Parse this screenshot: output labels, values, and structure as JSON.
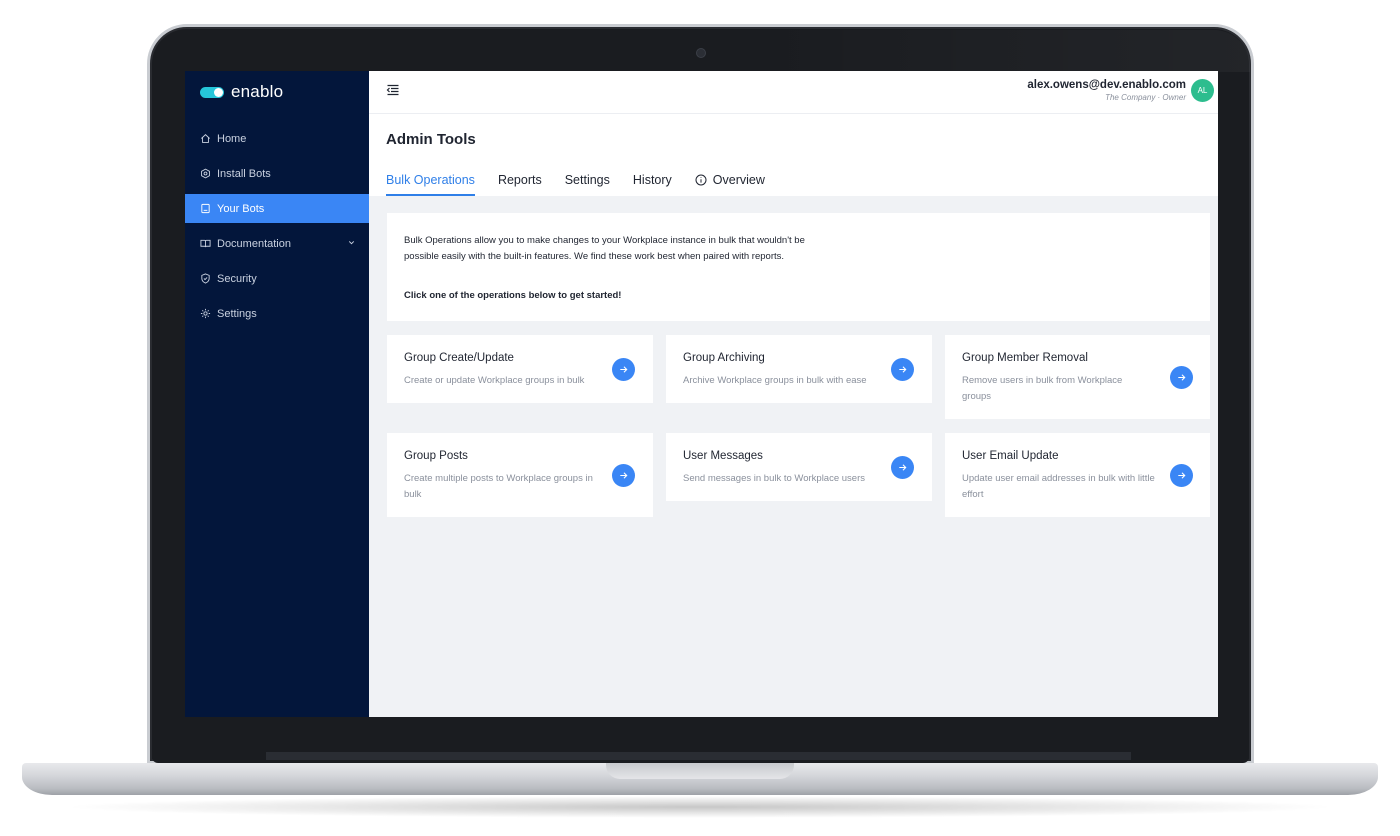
{
  "brand": {
    "name": "enablo",
    "logo_color": "#26c6da"
  },
  "sidebar": {
    "items": [
      {
        "label": "Home",
        "icon": "home-icon"
      },
      {
        "label": "Install Bots",
        "icon": "install-icon"
      },
      {
        "label": "Your Bots",
        "icon": "bot-icon",
        "active": true
      },
      {
        "label": "Documentation",
        "icon": "book-icon",
        "has_submenu": true
      },
      {
        "label": "Security",
        "icon": "shield-icon"
      },
      {
        "label": "Settings",
        "icon": "gear-icon"
      }
    ]
  },
  "header": {
    "menu_icon": "menu-collapse-icon",
    "user_email": "alex.owens@dev.enablo.com",
    "user_role": "The Company · Owner",
    "avatar_initials": "AL",
    "avatar_color": "#2dbd8e"
  },
  "page": {
    "title": "Admin Tools",
    "tabs": [
      {
        "label": "Bulk Operations",
        "active": true
      },
      {
        "label": "Reports"
      },
      {
        "label": "Settings"
      },
      {
        "label": "History"
      },
      {
        "label": "Overview",
        "icon": "info-icon"
      }
    ]
  },
  "intro": {
    "text": "Bulk Operations allow you to make changes to your Workplace instance in bulk that wouldn't be possible easily with the built-in features. We find these work best when paired with reports.",
    "cta": "Click one of the operations below to get started!"
  },
  "operations": [
    {
      "title": "Group Create/Update",
      "description": "Create or update Workplace groups in bulk"
    },
    {
      "title": "Group Archiving",
      "description": "Archive Workplace groups in bulk with ease"
    },
    {
      "title": "Group Member Removal",
      "description": "Remove users in bulk from Workplace groups"
    },
    {
      "title": "Group Posts",
      "description": "Create multiple posts to Workplace groups in bulk"
    },
    {
      "title": "User Messages",
      "description": "Send messages in bulk to Workplace users"
    },
    {
      "title": "User Email Update",
      "description": "Update user email addresses in bulk with little effort"
    }
  ],
  "colors": {
    "sidebar_bg": "#03163b",
    "accent": "#3a86f5",
    "tab_active": "#2f7fe8",
    "content_bg": "#f0f2f5"
  }
}
